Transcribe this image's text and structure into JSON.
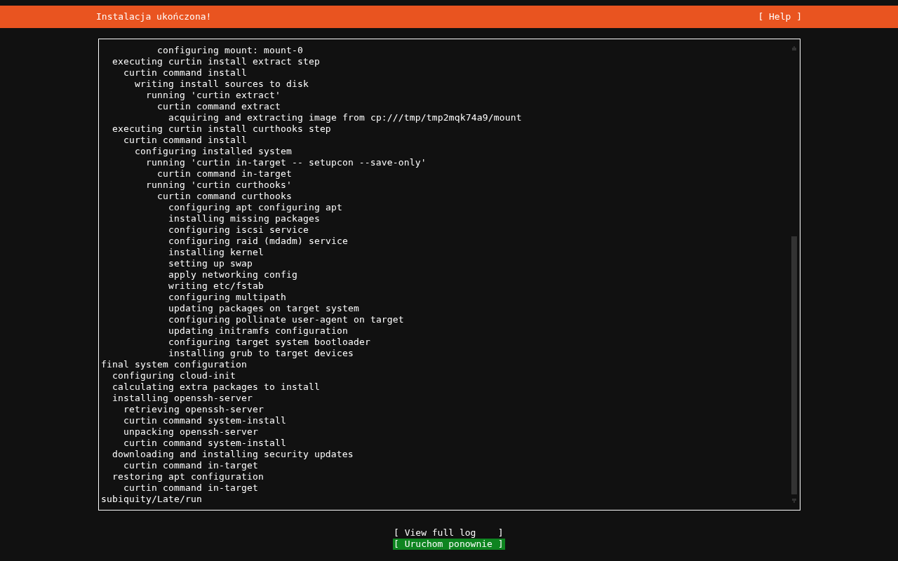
{
  "header": {
    "title": "Instalacja ukończona!",
    "help_button": "[ Help ]"
  },
  "log": [
    {
      "children": [
        {
          "children": [
            {
              "children": [
                {
                  "children": [
                    {
                      "children": [
                        {
                          "text": "configuring mount: mount-0"
                        }
                      ]
                    }
                  ]
                }
              ]
            }
          ]
        },
        {
          "text": "executing curtin install extract step",
          "children": [
            {
              "text": "curtin command install",
              "children": [
                {
                  "text": "writing install sources to disk",
                  "children": [
                    {
                      "text": "running 'curtin extract'",
                      "children": [
                        {
                          "text": "curtin command extract",
                          "children": [
                            {
                              "text": "acquiring and extracting image from cp:///tmp/tmp2mqk74a9/mount"
                            }
                          ]
                        }
                      ]
                    }
                  ]
                }
              ]
            }
          ]
        },
        {
          "text": "executing curtin install curthooks step",
          "children": [
            {
              "text": "curtin command install",
              "children": [
                {
                  "text": "configuring installed system",
                  "children": [
                    {
                      "text": "running 'curtin in-target -- setupcon --save-only'",
                      "children": [
                        {
                          "text": "curtin command in-target"
                        }
                      ]
                    },
                    {
                      "text": "running 'curtin curthooks'",
                      "children": [
                        {
                          "text": "curtin command curthooks",
                          "children": [
                            {
                              "text": "configuring apt configuring apt"
                            },
                            {
                              "text": "installing missing packages"
                            },
                            {
                              "text": "configuring iscsi service"
                            },
                            {
                              "text": "configuring raid (mdadm) service"
                            },
                            {
                              "text": "installing kernel"
                            },
                            {
                              "text": "setting up swap"
                            },
                            {
                              "text": "apply networking config"
                            },
                            {
                              "text": "writing etc/fstab"
                            },
                            {
                              "text": "configuring multipath"
                            },
                            {
                              "text": "updating packages on target system"
                            },
                            {
                              "text": "configuring pollinate user-agent on target"
                            },
                            {
                              "text": "updating initramfs configuration"
                            },
                            {
                              "text": "configuring target system bootloader"
                            },
                            {
                              "text": "installing grub to target devices"
                            }
                          ]
                        }
                      ]
                    }
                  ]
                }
              ]
            }
          ]
        }
      ]
    },
    {
      "text": "final system configuration",
      "children": [
        {
          "text": "configuring cloud-init"
        },
        {
          "text": "calculating extra packages to install"
        },
        {
          "text": "installing openssh-server",
          "children": [
            {
              "text": "retrieving openssh-server"
            },
            {
              "text": "curtin command system-install"
            },
            {
              "text": "unpacking openssh-server"
            },
            {
              "text": "curtin command system-install"
            }
          ]
        },
        {
          "text": "downloading and installing security updates",
          "children": [
            {
              "text": "curtin command in-target"
            }
          ]
        },
        {
          "text": "restoring apt configuration",
          "children": [
            {
              "text": "curtin command in-target"
            }
          ]
        }
      ]
    },
    {
      "text": "subiquity/Late/run"
    }
  ],
  "buttons": [
    {
      "label": "[ View full log    ]",
      "focused": false
    },
    {
      "label": "[ Uruchom ponownie ]",
      "focused": true
    }
  ]
}
